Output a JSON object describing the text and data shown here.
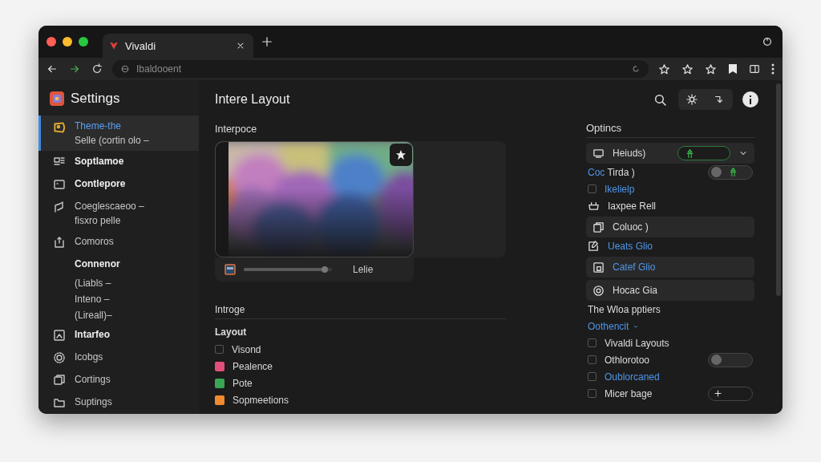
{
  "window": {
    "tab_title": "Vivaldi",
    "address": "Ibaldooent"
  },
  "sidebar": {
    "title": "Settings",
    "items": [
      {
        "lines": [
          "Theme-the",
          "Selle (cortin olo –"
        ],
        "strong": false,
        "selected": true
      },
      {
        "lines": [
          "Soptlamoe"
        ],
        "strong": true,
        "selected": false
      },
      {
        "lines": [
          "Contlepore"
        ],
        "strong": true,
        "selected": false
      },
      {
        "lines": [
          "Coeglescaeoo –",
          "fisxro pelle"
        ],
        "strong": false,
        "selected": false
      },
      {
        "lines": [
          "Comoros"
        ],
        "strong": false,
        "selected": false
      },
      {
        "lines": [
          "Connenor"
        ],
        "strong": true,
        "selected": false
      },
      {
        "lines": [
          "(Liabls –"
        ],
        "strong": false,
        "selected": false
      },
      {
        "lines": [
          "Inteno –"
        ],
        "strong": false,
        "selected": false
      },
      {
        "lines": [
          "(Lireall)–"
        ],
        "strong": false,
        "selected": false
      },
      {
        "lines": [
          "Intarfeo"
        ],
        "strong": true,
        "selected": false
      },
      {
        "lines": [
          "Icobgs"
        ],
        "strong": false,
        "selected": false
      },
      {
        "lines": [
          "Cortings"
        ],
        "strong": false,
        "selected": false
      },
      {
        "lines": [
          "Suptings"
        ],
        "strong": false,
        "selected": false
      }
    ]
  },
  "main": {
    "title": "Intere Layout",
    "preview": {
      "heading": "Interpoce",
      "level": 0.95,
      "caption": "Lelie"
    },
    "section": {
      "heading": "Introge",
      "subheading": "Layout",
      "items": [
        {
          "kind": "checkbox",
          "label": "Visond",
          "checked": false
        },
        {
          "kind": "swatch",
          "label": "Pealence",
          "color": "#e0507a"
        },
        {
          "kind": "swatch",
          "label": "Pote",
          "color": "#3aa655"
        },
        {
          "kind": "swatch",
          "label": "Sopmeetions",
          "color": "#f08a30"
        }
      ]
    }
  },
  "options": {
    "heading": "Optincs",
    "rows": [
      {
        "kind": "card",
        "label": "Heiuds)",
        "accent": false,
        "control": {
          "kind": "pill",
          "on": true
        }
      },
      {
        "kind": "plain",
        "prefix": "Coc",
        "label": "Tirda )",
        "accent": false,
        "control": {
          "kind": "toggle",
          "on": false
        }
      },
      {
        "kind": "checkbox",
        "label": "Ikelielp",
        "accent": true,
        "checked": false
      },
      {
        "kind": "icon",
        "label": "Iaxpee Rell",
        "accent": false
      },
      {
        "kind": "card",
        "label": "Coluoc )",
        "accent": false
      },
      {
        "kind": "icon",
        "label": "Ueats Glio",
        "accent": true
      },
      {
        "kind": "card",
        "label": "Catef Glio",
        "accent": true
      },
      {
        "kind": "card",
        "label": "Hocac Gia",
        "accent": false
      },
      {
        "kind": "heading",
        "label": "The Wloa pptiers",
        "accent": false
      },
      {
        "kind": "dropdown",
        "label": "Oothencit",
        "accent": true
      },
      {
        "kind": "checkbox",
        "label": "Vivaldi Layouts",
        "accent": false,
        "checked": false
      },
      {
        "kind": "checkbox",
        "label": "Othlorotoo",
        "accent": false,
        "checked": false,
        "control": {
          "kind": "toggle",
          "on": false
        }
      },
      {
        "kind": "checkbox",
        "label": "Oublorcaned",
        "accent": true,
        "checked": false
      },
      {
        "kind": "checkbox",
        "label": "Micer bage",
        "accent": false,
        "checked": false,
        "control": {
          "kind": "add"
        }
      }
    ]
  }
}
